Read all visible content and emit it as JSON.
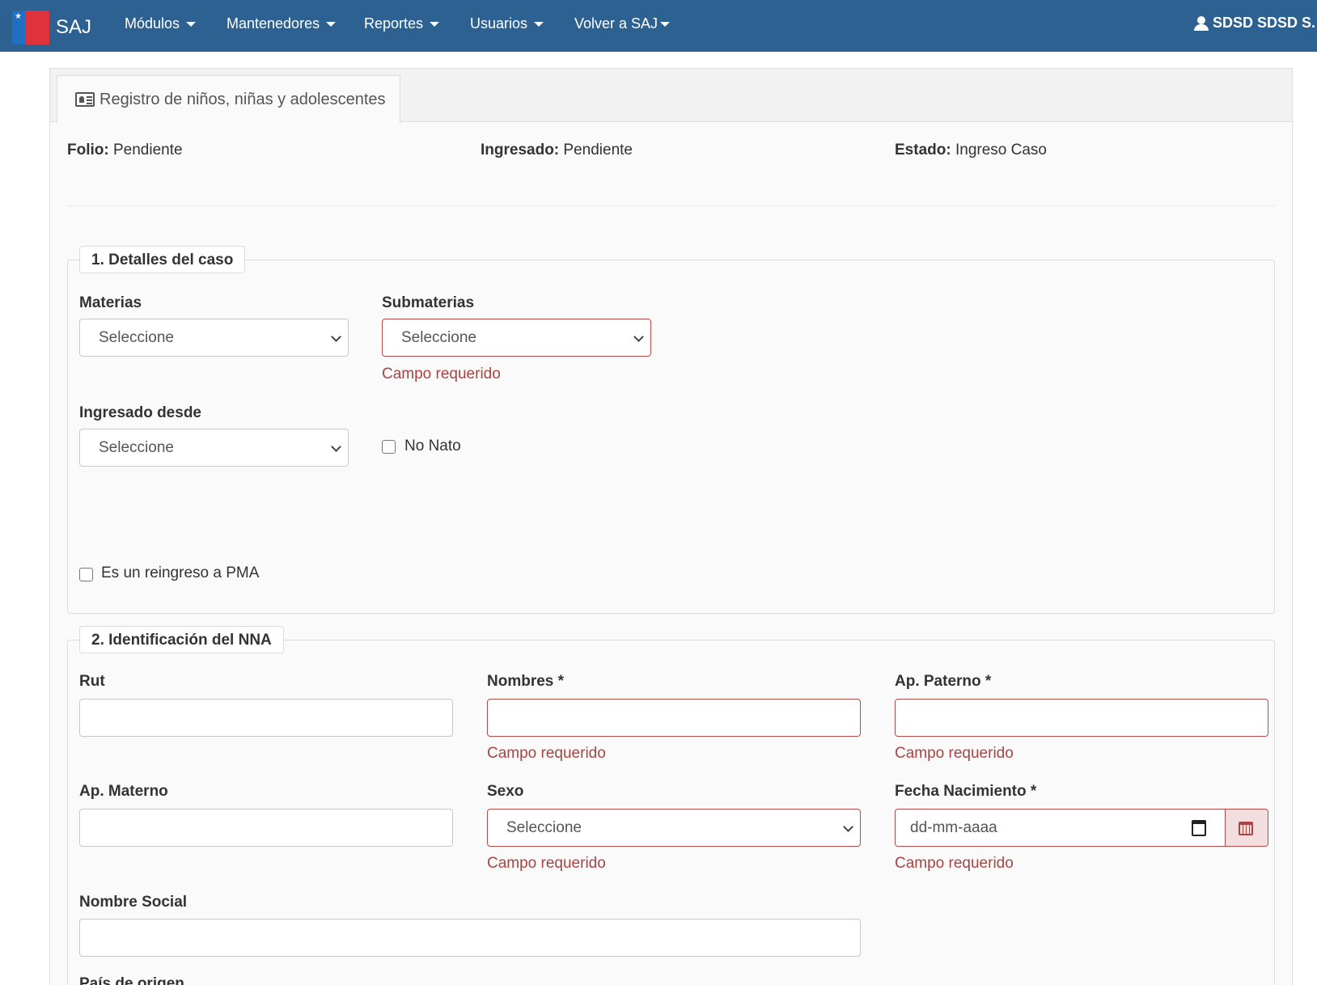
{
  "navbar": {
    "brand": "SAJ",
    "items": [
      {
        "label": "Módulos"
      },
      {
        "label": "Mantenedores"
      },
      {
        "label": "Reportes"
      },
      {
        "label": "Usuarios"
      },
      {
        "label": "Volver a SAJ"
      }
    ],
    "user": "SDSD SDSD S."
  },
  "tab": {
    "label": "Registro de niños, niñas y adolescentes"
  },
  "meta": {
    "folio_label": "Folio:",
    "folio_value": "Pendiente",
    "ingresado_label": "Ingresado:",
    "ingresado_value": "Pendiente",
    "estado_label": "Estado:",
    "estado_value": "Ingreso Caso"
  },
  "section1": {
    "legend": "1. Detalles del caso",
    "materias_label": "Materias",
    "materias_value": "Seleccione",
    "submaterias_label": "Submaterias",
    "submaterias_value": "Seleccione",
    "submaterias_error": "Campo requerido",
    "ingresado_desde_label": "Ingresado desde",
    "ingresado_desde_value": "Seleccione",
    "no_nato_label": "No Nato",
    "reingreso_label": "Es un reingreso a PMA"
  },
  "section2": {
    "legend": "2. Identificación del NNA",
    "rut_label": "Rut",
    "nombres_label": "Nombres *",
    "nombres_error": "Campo requerido",
    "ap_paterno_label": "Ap. Paterno *",
    "ap_paterno_error": "Campo requerido",
    "ap_materno_label": "Ap. Materno",
    "sexo_label": "Sexo",
    "sexo_value": "Seleccione",
    "sexo_error": "Campo requerido",
    "fecha_label": "Fecha Nacimiento *",
    "fecha_placeholder": "dd-mm-aaaa",
    "fecha_error": "Campo requerido",
    "nombre_social_label": "Nombre Social",
    "pais_label": "País de origen"
  },
  "colors": {
    "navbar": "#2c6192",
    "error": "#a94442"
  }
}
